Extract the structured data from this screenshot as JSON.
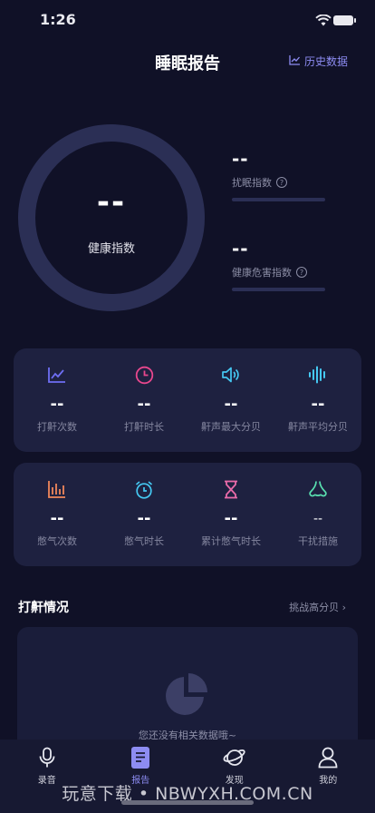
{
  "status_bar": {
    "time": "1:26"
  },
  "header": {
    "title": "睡眠报告",
    "history_label": "历史数据"
  },
  "health": {
    "value": "--",
    "label": "健康指数"
  },
  "metrics": [
    {
      "value": "--",
      "label": "扰眠指数"
    },
    {
      "value": "--",
      "label": "健康危害指数"
    }
  ],
  "snore_stats": [
    {
      "icon": "line-chart-icon",
      "color": "#6e6ef3",
      "value": "--",
      "label": "打鼾次数"
    },
    {
      "icon": "clock-icon",
      "color": "#e8478d",
      "value": "--",
      "label": "打鼾时长"
    },
    {
      "icon": "volume-icon",
      "color": "#45c8f2",
      "value": "--",
      "label": "鼾声最大分贝"
    },
    {
      "icon": "soundwave-icon",
      "color": "#45c8f2",
      "value": "--",
      "label": "鼾声平均分贝"
    }
  ],
  "apnea_stats": [
    {
      "icon": "bar-chart-icon",
      "color": "#f0875a",
      "value": "--",
      "label": "憋气次数"
    },
    {
      "icon": "alarm-clock-icon",
      "color": "#45c8f2",
      "value": "--",
      "label": "憋气时长"
    },
    {
      "icon": "hourglass-icon",
      "color": "#e86aa8",
      "value": "--",
      "label": "累计憋气时长"
    },
    {
      "icon": "nose-icon",
      "color": "#59e0b0",
      "value": "--",
      "label": "干扰措施"
    }
  ],
  "snore_section": {
    "title": "打鼾情况",
    "link": "挑战高分贝 ›"
  },
  "empty_state": {
    "text": "您还没有相关数据哦~"
  },
  "tabs": [
    {
      "label": "录音",
      "icon": "microphone-icon"
    },
    {
      "label": "报告",
      "icon": "report-icon",
      "active": true
    },
    {
      "label": "发现",
      "icon": "planet-icon"
    },
    {
      "label": "我的",
      "icon": "user-icon"
    }
  ],
  "watermark": "玩意下载 • NBWYXH.COM.CN"
}
